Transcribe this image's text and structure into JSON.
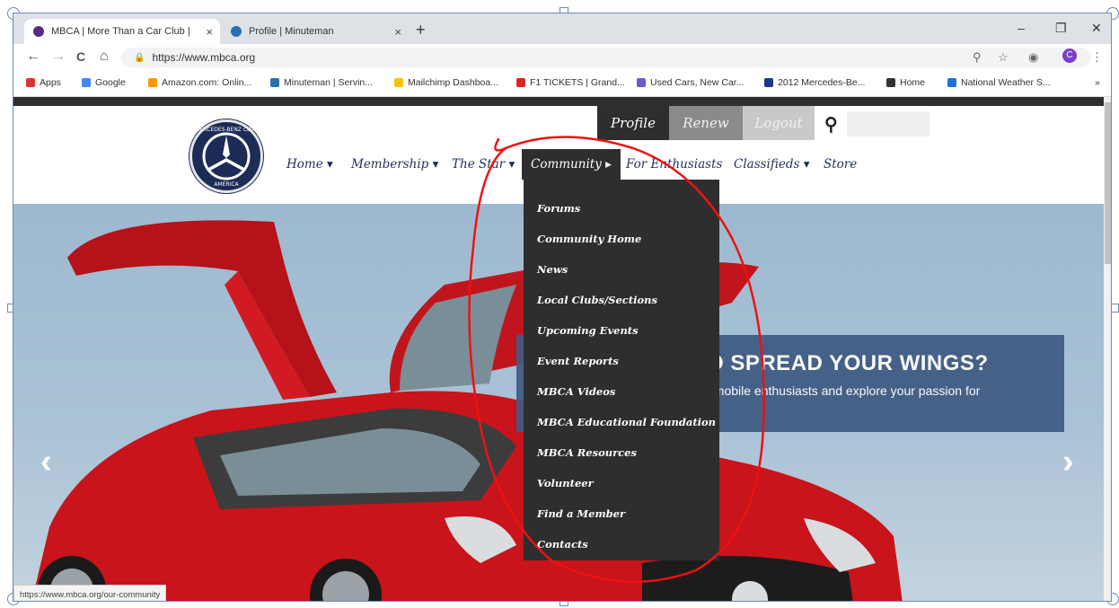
{
  "browser": {
    "tabs": [
      {
        "title": "MBCA | More Than a Car Club | ",
        "favicon_color": "#5a2a86"
      },
      {
        "title": "Profile | Minuteman",
        "favicon_color": "#2a6fb0"
      }
    ],
    "new_tab_glyph": "+",
    "close_glyph": "×",
    "window_controls": {
      "minimize": "–",
      "restore": "❐",
      "close": "✕"
    },
    "nav": {
      "back": "←",
      "forward": "→",
      "reload": "C",
      "home": "⌂"
    },
    "url": "https://www.mbca.org",
    "toolbar_icons": [
      "zoom-icon",
      "star-icon",
      "extension-icon",
      "profile-icon",
      "menu-icon"
    ],
    "bookmarks": [
      {
        "label": "Apps",
        "color": "#d33"
      },
      {
        "label": "Google",
        "color": "#4285f4"
      },
      {
        "label": "Amazon.com: Onlin...",
        "color": "#f90"
      },
      {
        "label": "Minuteman | Servin...",
        "color": "#2a6fb0"
      },
      {
        "label": "Mailchimp Dashboa...",
        "color": "#f5c400"
      },
      {
        "label": "F1 TICKETS | Grand...",
        "color": "#d22"
      },
      {
        "label": "Used Cars, New Car...",
        "color": "#6a5acd"
      },
      {
        "label": "2012 Mercedes-Be...",
        "color": "#1a3a8a"
      },
      {
        "label": "Home",
        "color": "#333"
      },
      {
        "label": "National Weather S...",
        "color": "#1f6fd1"
      }
    ],
    "bookmarks_overflow": "»",
    "status_url": "https://www.mbca.org/our-community"
  },
  "site": {
    "account": {
      "profile": "Profile",
      "renew": "Renew",
      "logout": "Logout"
    },
    "nav": [
      {
        "label": "Home ▾"
      },
      {
        "label": "Membership ▾"
      },
      {
        "label": "The Star ▾"
      },
      {
        "label": "Community ▸"
      },
      {
        "label": "For Enthusiasts"
      },
      {
        "label": "Classifieds ▾"
      },
      {
        "label": "Store"
      }
    ],
    "logo": {
      "top_text": "MERCEDES-BENZ CLUB",
      "bottom_text": "AMERICA"
    },
    "community_menu": [
      "Forums",
      "Community Home",
      "News",
      "Local Clubs/Sections",
      "Upcoming Events",
      "Event Reports",
      "MBCA Videos",
      "MBCA Educational Foundation",
      "MBCA Resources",
      "Volunteer",
      "Find a Member",
      "Contacts"
    ],
    "hero": {
      "title": "O SPREAD YOUR WINGS?",
      "subtitle": "omobile enthusiasts and explore your passion for",
      "prev_arrow": "‹",
      "next_arrow": "›"
    }
  },
  "colors": {
    "accent_red": "#e11",
    "nav_blue": "#1f2f5a",
    "menu_bg": "#2e2e2e"
  }
}
